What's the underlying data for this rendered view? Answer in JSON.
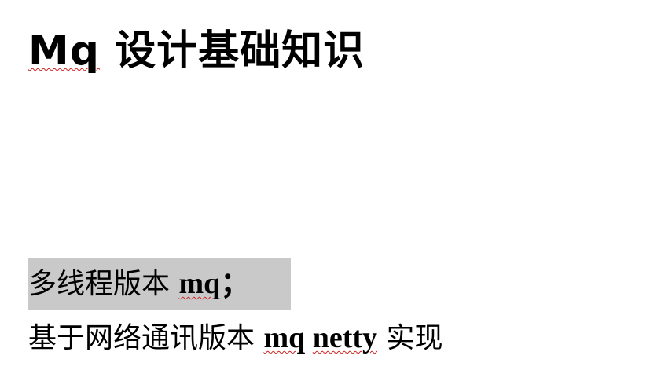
{
  "title": {
    "latin": "Mq",
    "text": " 设计基础知识"
  },
  "lines": [
    {
      "cn": "多线程版本 ",
      "latin": "mq",
      "tail": "；"
    },
    {
      "cn": "基于网络通讯版本 ",
      "latin1": "mq",
      "space": " ",
      "latin2": "netty",
      "tail": " 实现"
    }
  ],
  "colors": {
    "highlight": "#c9c9c9",
    "spellcheck": "#d02020"
  }
}
